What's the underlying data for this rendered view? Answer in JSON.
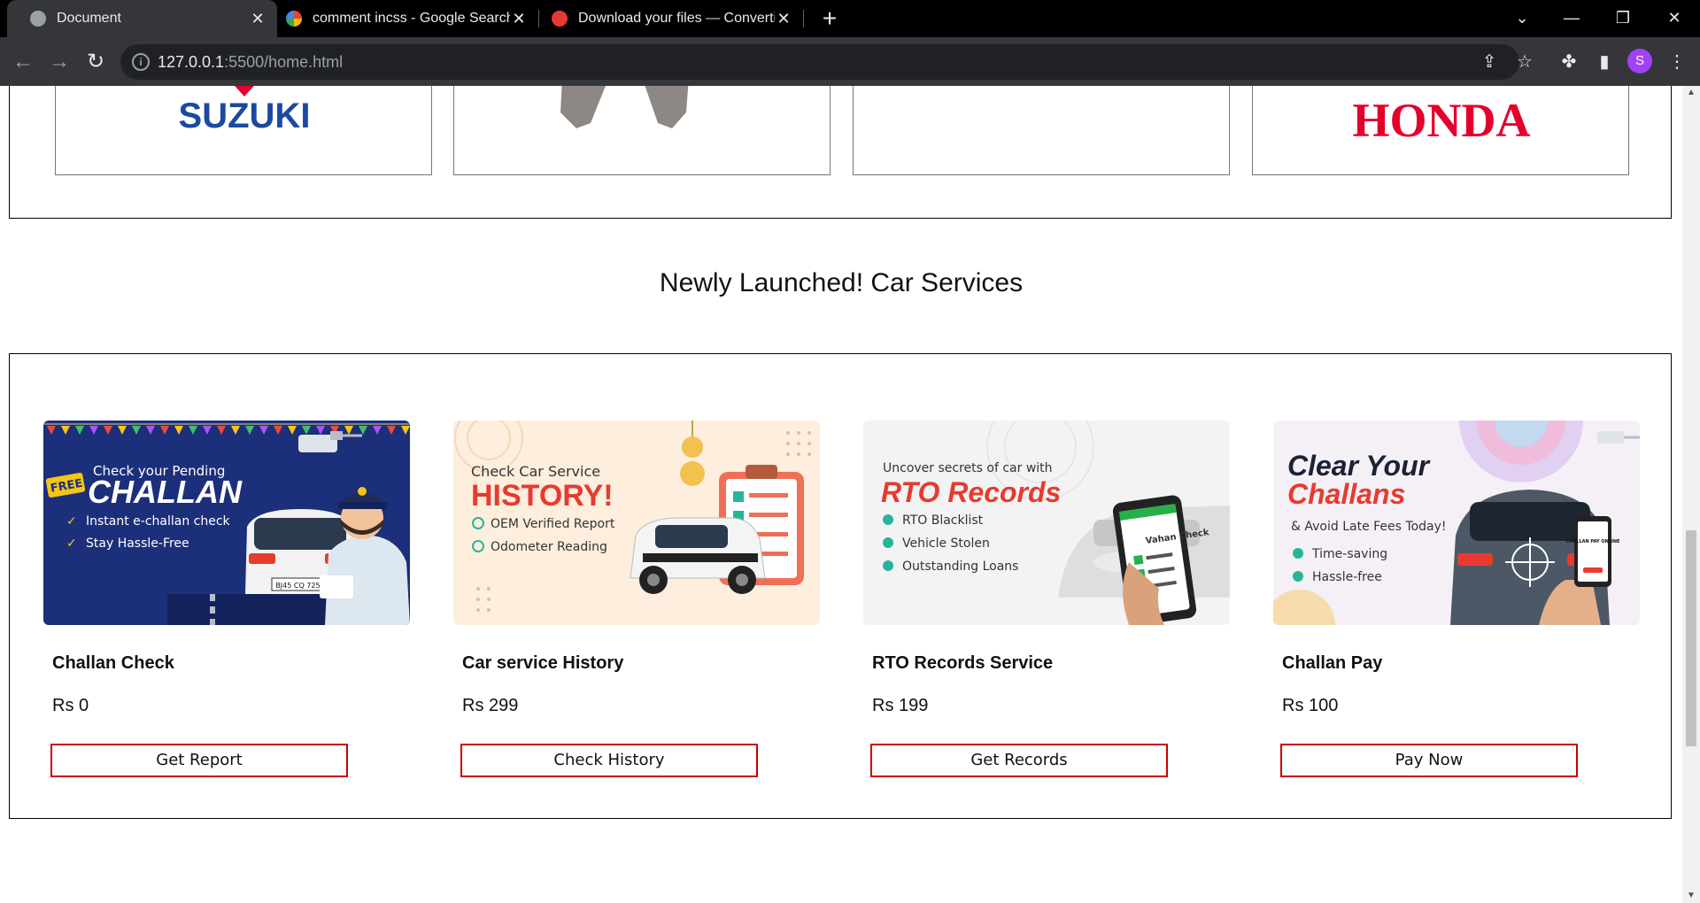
{
  "browser": {
    "tabs": [
      {
        "title": "Document",
        "active": true
      },
      {
        "title": "comment incss - Google Search",
        "active": false
      },
      {
        "title": "Download your files — Converti",
        "active": false
      }
    ],
    "url_host": "127.0.0.1",
    "url_path": ":5500/home.html",
    "profile_initial": "S"
  },
  "brands": [
    "SUZUKI",
    "",
    "",
    "HONDA"
  ],
  "section": {
    "title": "Newly Launched! Car Services"
  },
  "services": [
    {
      "name": "Challan Check",
      "price": "Rs 0",
      "button": "Get Report",
      "image": {
        "pre": "Check your Pending",
        "badge": "FREE",
        "headline": "CHALLAN",
        "bullets": [
          "Instant e-challan check",
          "Stay Hassle-Free"
        ],
        "plate": "BJ45 CQ 7251",
        "bg": "#1c2f7a"
      }
    },
    {
      "name": "Car service History",
      "price": "Rs 299",
      "button": "Check History",
      "image": {
        "pre": "Check Car Service",
        "headline": "HISTORY!",
        "bullets": [
          "OEM Verified Report",
          "Odometer Reading"
        ],
        "bg": "#fdeedd"
      }
    },
    {
      "name": "RTO Records Service",
      "price": "Rs 199",
      "button": "Get Records",
      "image": {
        "pre": "Uncover secrets of car with",
        "headline": "RTO Records",
        "bullets": [
          "RTO Blacklist",
          "Vehicle Stolen",
          "Outstanding Loans"
        ],
        "phone_text": "Vahan Check",
        "bg": "#f3f3f3"
      }
    },
    {
      "name": "Challan Pay",
      "price": "Rs 100",
      "button": "Pay Now",
      "image": {
        "headline1": "Clear Your",
        "headline2": "Challans",
        "sub": "& Avoid Late Fees Today!",
        "bullets": [
          "Time-saving",
          "Hassle-free"
        ],
        "phone_text": "CHALLAN PAY ONLINE",
        "bg": "#f4f0f6"
      }
    }
  ],
  "colors": {
    "accent_red": "#cc0000",
    "challan_red": "#e63b2e",
    "teal": "#27b59a"
  }
}
